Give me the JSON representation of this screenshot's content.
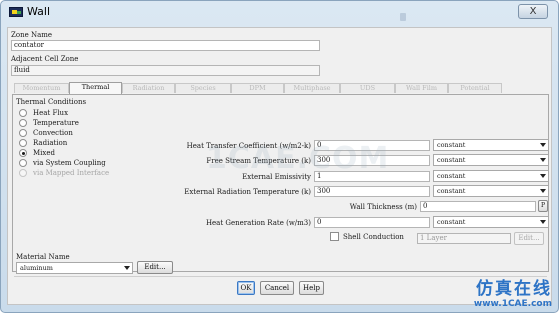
{
  "window": {
    "title": "Wall",
    "close_glyph": "X"
  },
  "zone_name": {
    "label": "Zone Name",
    "value": "contator"
  },
  "adjacent_cell_zone": {
    "label": "Adjacent Cell Zone",
    "value": "fluid"
  },
  "tabs": [
    {
      "label": "Momentum",
      "active": false
    },
    {
      "label": "Thermal",
      "active": true
    },
    {
      "label": "Radiation",
      "active": false
    },
    {
      "label": "Species",
      "active": false
    },
    {
      "label": "DPM",
      "active": false
    },
    {
      "label": "Multiphase",
      "active": false
    },
    {
      "label": "UDS",
      "active": false
    },
    {
      "label": "Wall Film",
      "active": false
    },
    {
      "label": "Potential",
      "active": false
    }
  ],
  "thermal_conditions": {
    "label": "Thermal Conditions",
    "options": [
      {
        "label": "Heat Flux",
        "selected": false,
        "disabled": false
      },
      {
        "label": "Temperature",
        "selected": false,
        "disabled": false
      },
      {
        "label": "Convection",
        "selected": false,
        "disabled": false
      },
      {
        "label": "Radiation",
        "selected": false,
        "disabled": false
      },
      {
        "label": "Mixed",
        "selected": true,
        "disabled": false
      },
      {
        "label": "via System Coupling",
        "selected": false,
        "disabled": false
      },
      {
        "label": "via Mapped Interface",
        "selected": false,
        "disabled": true
      }
    ]
  },
  "properties": [
    {
      "label": "Heat Transfer Coefficient (w/m2-k)",
      "value": "0",
      "method": "constant"
    },
    {
      "label": "Free Stream Temperature (k)",
      "value": "300",
      "method": "constant"
    },
    {
      "label": "External Emissivity",
      "value": "1",
      "method": "constant"
    },
    {
      "label": "External Radiation Temperature (k)",
      "value": "300",
      "method": "constant"
    }
  ],
  "wall_thickness": {
    "label": "Wall Thickness (m)",
    "value": "0",
    "button": "P"
  },
  "heat_generation": {
    "label": "Heat Generation Rate (w/m3)",
    "value": "0",
    "method": "constant"
  },
  "shell_conduction": {
    "label": "Shell Conduction",
    "checked": false,
    "layers": "1 Layer",
    "edit": "Edit..."
  },
  "material": {
    "label": "Material Name",
    "value": "aluminum",
    "edit": "Edit..."
  },
  "buttons": {
    "ok": "OK",
    "cancel": "Cancel",
    "help": "Help"
  },
  "watermark": {
    "center": "1CAE.COM",
    "cn": "仿真在线",
    "url": "www.1CAE.com"
  },
  "colors": {
    "accent": "#2e74c6",
    "title_bg": "#c9dbeb"
  }
}
